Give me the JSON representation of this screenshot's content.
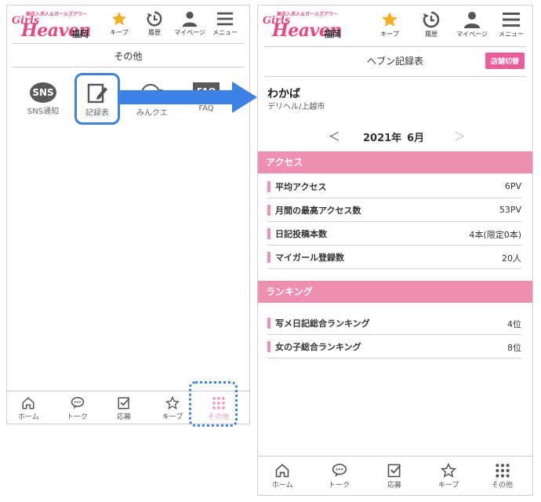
{
  "header": {
    "logo_tagline": "高収入求人＆ガールズアワー",
    "logo_girl": "Girls",
    "logo_heaven": "Heaven",
    "logo_city": "福岡",
    "nav": [
      {
        "id": "keep",
        "label": "キープ",
        "icon": "star-icon",
        "color": "#f5b01e"
      },
      {
        "id": "history",
        "label": "履歴",
        "icon": "history-icon"
      },
      {
        "id": "mypage",
        "label": "マイページ",
        "icon": "user-icon"
      },
      {
        "id": "menu",
        "label": "メニュー",
        "icon": "hamburger-icon"
      }
    ]
  },
  "left": {
    "section_title": "その他",
    "tiles": [
      {
        "id": "sns",
        "badge": "SNS",
        "label": "SNS通知",
        "icon": "sns-bubble-icon"
      },
      {
        "id": "record",
        "label": "記録表",
        "icon": "record-edit-icon"
      },
      {
        "id": "minkue",
        "label": "みんクエ",
        "icon": "minkue-icon"
      },
      {
        "id": "faq",
        "badge": "FAQ",
        "label": "FAQ",
        "icon": "faq-icon"
      }
    ]
  },
  "right": {
    "page_title": "ヘブン記録表",
    "store_switch": "店舗切替",
    "girl_name": "わかば",
    "girl_area": "デリヘル/上越市",
    "prev_symbol": "＜",
    "next_symbol": "＞",
    "year": "2021年",
    "month": "6月",
    "access_title": "アクセス",
    "access_rows": [
      {
        "label": "平均アクセス",
        "value": "6PV"
      },
      {
        "label": "月間の最高アクセス数",
        "value": "53PV"
      },
      {
        "label": "日記投稿本数",
        "value": "4本(限定0本)"
      },
      {
        "label": "マイガール登録数",
        "value": "20人"
      }
    ],
    "ranking_title": "ランキング",
    "ranking_rows": [
      {
        "label": "写メ日記総合ランキング",
        "value": "4位"
      },
      {
        "label": "女の子総合ランキング",
        "value": "8位"
      }
    ]
  },
  "tabbar": [
    {
      "id": "home",
      "label": "ホーム",
      "icon": "home-icon"
    },
    {
      "id": "talk",
      "label": "トーク",
      "icon": "chat-icon"
    },
    {
      "id": "apply",
      "label": "応募",
      "icon": "apply-icon"
    },
    {
      "id": "keep",
      "label": "キープ",
      "icon": "star-outline-icon"
    },
    {
      "id": "other",
      "label": "その他",
      "icon": "grid-dots-icon"
    }
  ],
  "colors": {
    "brand_pink": "#e8477d",
    "band_pink": "#ef8fb0",
    "switch_pink": "#ec5c98",
    "highlight_blue": "#3c82e6",
    "active_tab_pink": "#f29bb8"
  }
}
